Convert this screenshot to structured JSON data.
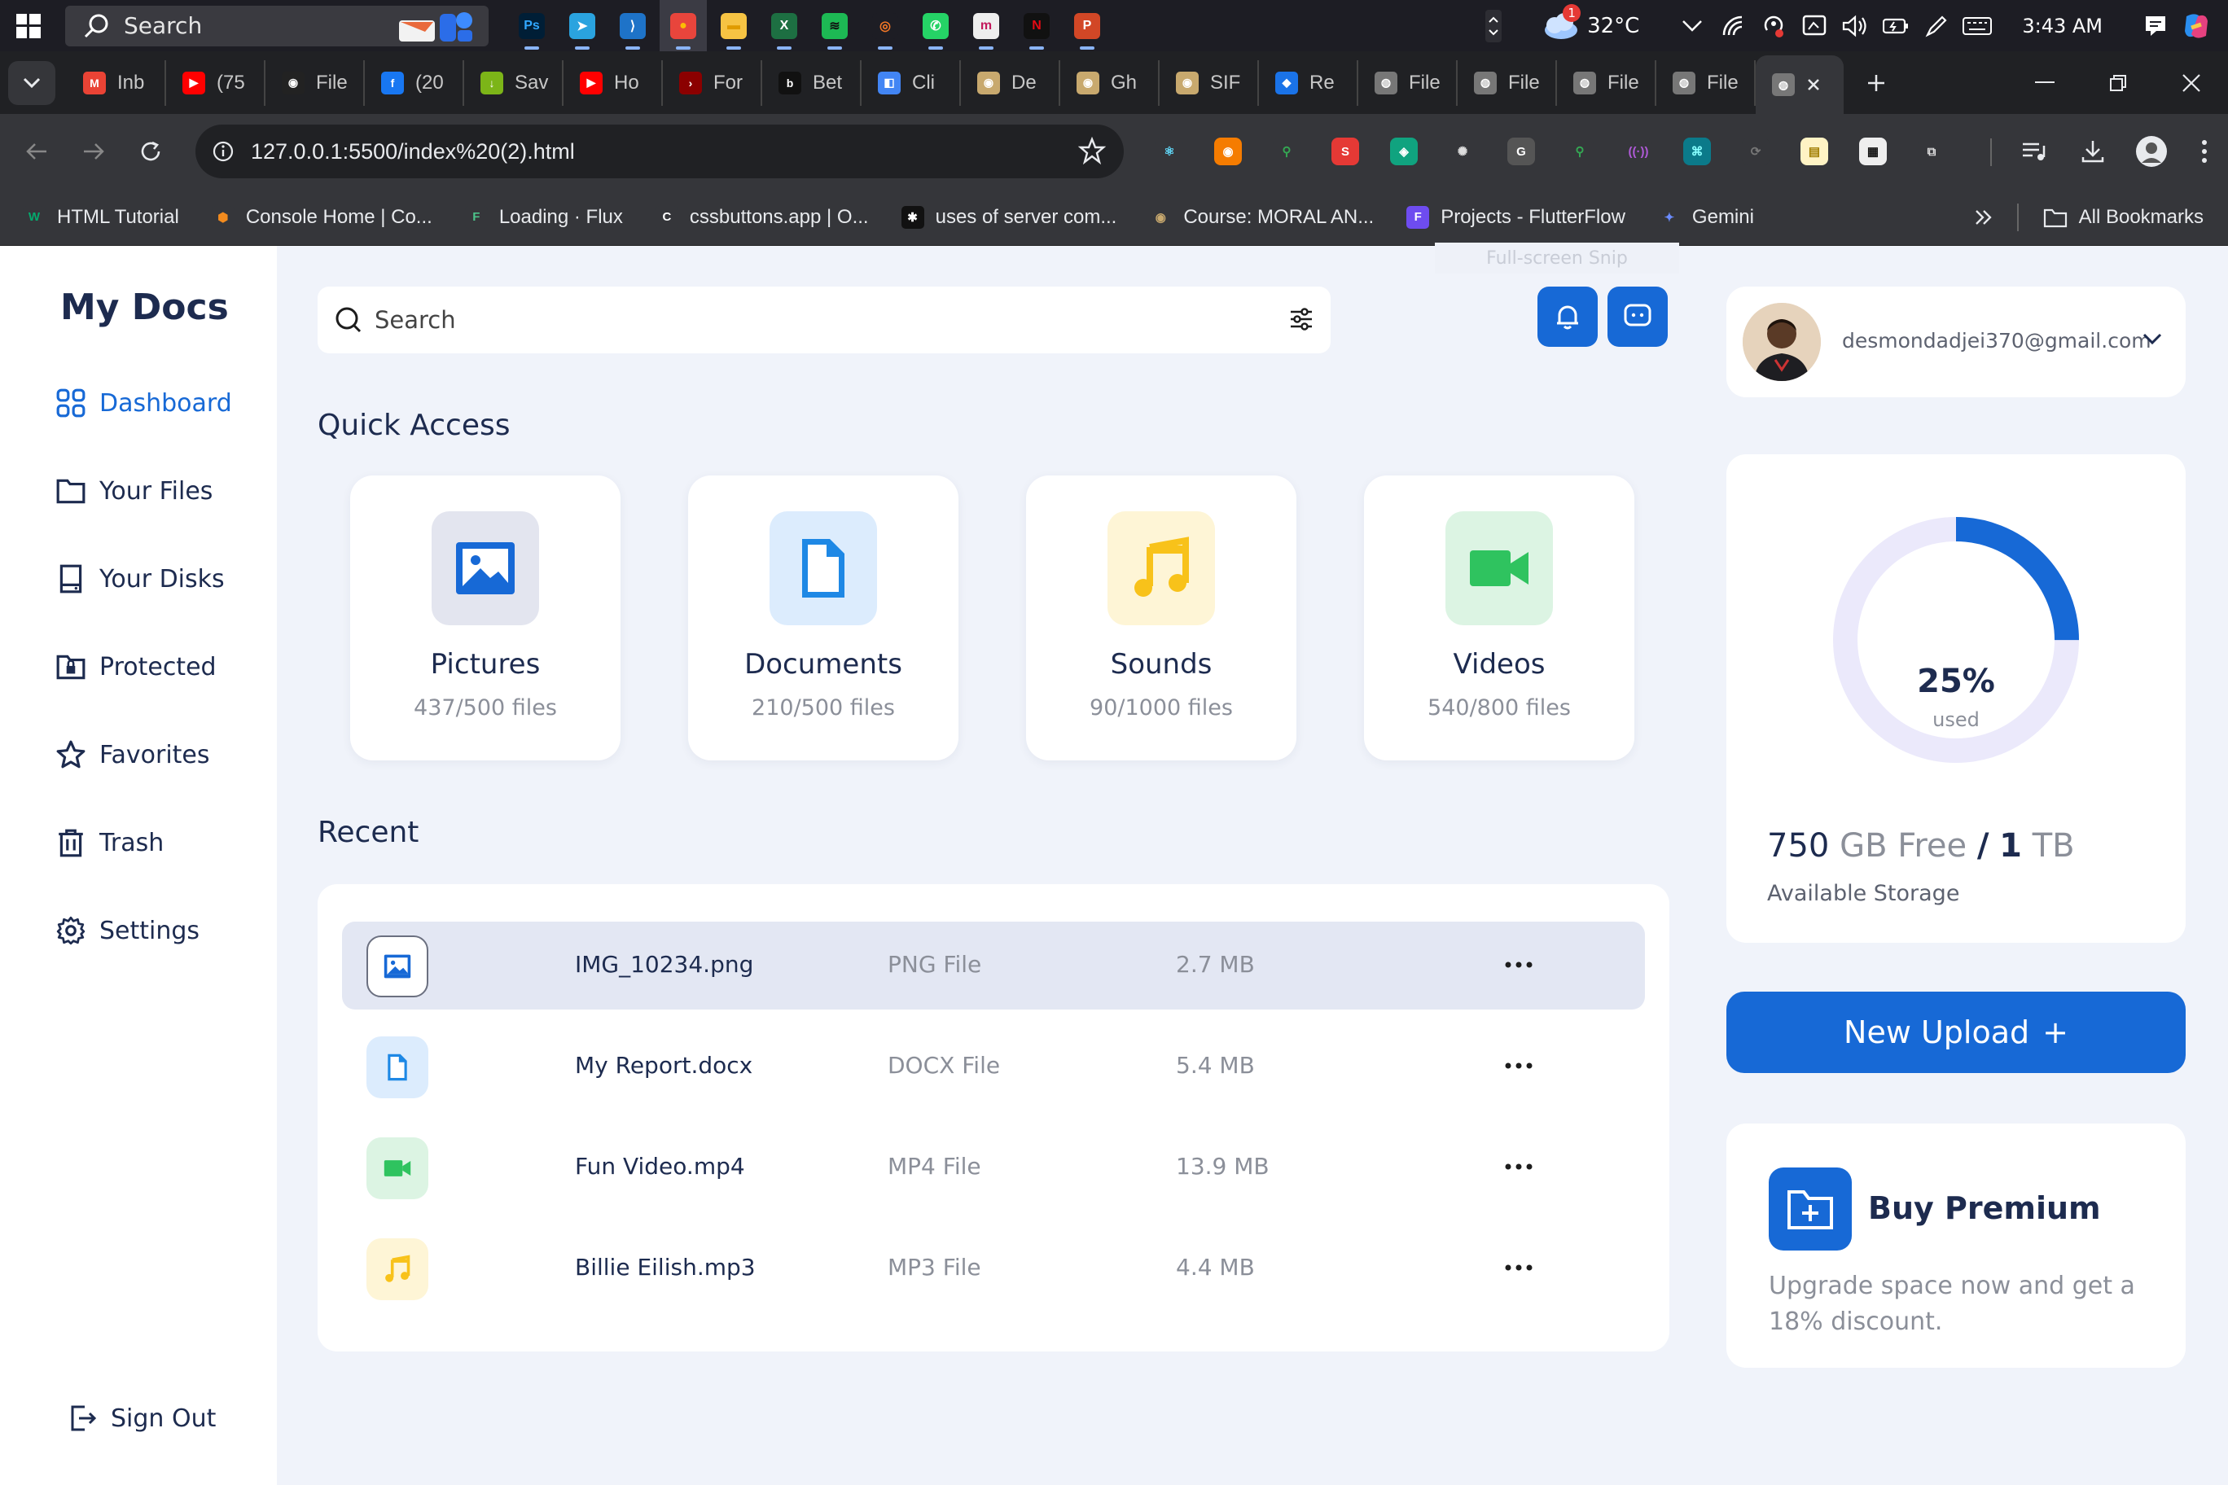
{
  "taskbar": {
    "search_placeholder": "Search",
    "apps": [
      {
        "name": "photoshop",
        "glyph": "Ps",
        "color": "#001e36",
        "fg": "#31a8ff"
      },
      {
        "name": "telegram",
        "glyph": "➤",
        "color": "#2aa3df",
        "fg": "#fff"
      },
      {
        "name": "vscode",
        "glyph": "⟩",
        "color": "#1e73c8",
        "fg": "#fff"
      },
      {
        "name": "chrome",
        "glyph": "●",
        "color": "#e8453c",
        "fg": "#fbbc05",
        "active": true
      },
      {
        "name": "file-explorer",
        "glyph": "▬",
        "color": "#f6c343",
        "fg": "#e09b00"
      },
      {
        "name": "excel",
        "glyph": "X",
        "color": "#1d6f42",
        "fg": "#fff"
      },
      {
        "name": "spotify",
        "glyph": "≋",
        "color": "#1db954",
        "fg": "#111"
      },
      {
        "name": "jupyter",
        "glyph": "◎",
        "color": "#1d1d24",
        "fg": "#f37726"
      },
      {
        "name": "whatsapp",
        "glyph": "✆",
        "color": "#25d366",
        "fg": "#fff"
      },
      {
        "name": "edge-app",
        "glyph": "m",
        "color": "#eee",
        "fg": "#c2185b"
      },
      {
        "name": "netflix",
        "glyph": "N",
        "color": "#111",
        "fg": "#e50914"
      },
      {
        "name": "powerpoint",
        "glyph": "P",
        "color": "#d24726",
        "fg": "#fff"
      }
    ],
    "weather_temp": "32°C",
    "weather_badge": "1",
    "time": "3:43 AM"
  },
  "tabs": [
    {
      "label": "Inb",
      "favicon": "M",
      "color": "#ea4335"
    },
    {
      "label": "(75",
      "favicon": "▶",
      "color": "#ff0000"
    },
    {
      "label": "File",
      "favicon": "◉",
      "color": "#222"
    },
    {
      "label": "(20",
      "favicon": "f",
      "color": "#1877f2"
    },
    {
      "label": "Sav",
      "favicon": "↓",
      "color": "#7cb518"
    },
    {
      "label": "Ho",
      "favicon": "▶",
      "color": "#ff0000"
    },
    {
      "label": "For",
      "favicon": "›",
      "color": "#8b0000"
    },
    {
      "label": "Bet",
      "favicon": "b",
      "color": "#111"
    },
    {
      "label": "Cli",
      "favicon": "◧",
      "color": "#4285f4"
    },
    {
      "label": "De",
      "favicon": "◉",
      "color": "#c8a96e"
    },
    {
      "label": "Gh",
      "favicon": "◉",
      "color": "#c8a96e"
    },
    {
      "label": "SIF",
      "favicon": "◉",
      "color": "#c8a96e"
    },
    {
      "label": "Re",
      "favicon": "◆",
      "color": "#1a73e8"
    },
    {
      "label": "File",
      "favicon": "◍",
      "color": "#777"
    },
    {
      "label": "File",
      "favicon": "◍",
      "color": "#777"
    },
    {
      "label": "File",
      "favicon": "◍",
      "color": "#777"
    },
    {
      "label": "File",
      "favicon": "◍",
      "color": "#777"
    }
  ],
  "browser": {
    "url": "127.0.0.1:5500/index%20(2).html"
  },
  "extensions": [
    {
      "name": "react-devtools",
      "glyph": "⚛",
      "color": "#35363a",
      "fg": "#61dafb"
    },
    {
      "name": "ext-orange",
      "glyph": "◉",
      "color": "#f57c00",
      "fg": "#fff"
    },
    {
      "name": "ext-green-search",
      "glyph": "⚲",
      "color": "#35363a",
      "fg": "#34a853"
    },
    {
      "name": "ext-s",
      "glyph": "S",
      "color": "#e53935",
      "fg": "#fff"
    },
    {
      "name": "ext-teal",
      "glyph": "◈",
      "color": "#10a37f",
      "fg": "#fff"
    },
    {
      "name": "openai",
      "glyph": "✺",
      "color": "#35363a",
      "fg": "#ddd"
    },
    {
      "name": "grammarly",
      "glyph": "G",
      "color": "#555",
      "fg": "#fff"
    },
    {
      "name": "ext-search",
      "glyph": "⚲",
      "color": "#35363a",
      "fg": "#34a853"
    },
    {
      "name": "ext-purple",
      "glyph": "((·))",
      "color": "#35363a",
      "fg": "#b05ad8"
    },
    {
      "name": "ext-cyan",
      "glyph": "⌘",
      "color": "#0b7a8a",
      "fg": "#8ff"
    },
    {
      "name": "ext-sync",
      "glyph": "⟳",
      "color": "#35363a",
      "fg": "#777"
    },
    {
      "name": "ext-note",
      "glyph": "▤",
      "color": "#fff3c4",
      "fg": "#a07d00"
    },
    {
      "name": "ext-qr",
      "glyph": "▦",
      "color": "#eee",
      "fg": "#111"
    },
    {
      "name": "puzzle",
      "glyph": "⧉",
      "color": "#35363a",
      "fg": "#ddd"
    }
  ],
  "bookmarks": [
    {
      "label": "HTML Tutorial",
      "icon": "W",
      "color": "#35363a",
      "fg": "#04aa6d"
    },
    {
      "label": "Console Home | Co...",
      "icon": "⬢",
      "color": "#35363a",
      "fg": "#f28b1e"
    },
    {
      "label": "Loading · Flux",
      "icon": "F",
      "color": "#35363a",
      "fg": "#4cc38a"
    },
    {
      "label": "cssbuttons.app | O...",
      "icon": "C",
      "color": "#35363a",
      "fg": "#fff"
    },
    {
      "label": "uses of server com...",
      "icon": "✱",
      "color": "#111",
      "fg": "#fff"
    },
    {
      "label": "Course: MORAL AN...",
      "icon": "◉",
      "color": "#35363a",
      "fg": "#c8a96e"
    },
    {
      "label": "Projects - FlutterFlow",
      "icon": "F",
      "color": "#6e4cf0",
      "fg": "#fff"
    },
    {
      "label": "Gemini",
      "icon": "✦",
      "color": "#35363a",
      "fg": "#6b8cff"
    }
  ],
  "bookmarks_all": "All Bookmarks",
  "snip_tooltip": "Full-screen Snip",
  "app": {
    "brand": "My Docs",
    "nav": [
      {
        "label": "Dashboard",
        "icon": "grid-icon",
        "active": true
      },
      {
        "label": "Your Files",
        "icon": "folder-icon"
      },
      {
        "label": "Your Disks",
        "icon": "disk-icon"
      },
      {
        "label": "Protected",
        "icon": "lock-folder-icon"
      },
      {
        "label": "Favorites",
        "icon": "star-icon"
      },
      {
        "label": "Trash",
        "icon": "trash-icon"
      },
      {
        "label": "Settings",
        "icon": "gear-icon"
      }
    ],
    "sign_out": "Sign Out",
    "search_placeholder": "Search",
    "quick_access_title": "Quick Access",
    "quick_access": [
      {
        "name": "Pictures",
        "count": "437/500 files",
        "icon": "image-icon",
        "tile": "#e3e5ef",
        "accent": "#1769d6"
      },
      {
        "name": "Documents",
        "count": "210/500 files",
        "icon": "document-icon",
        "tile": "#dcecfd",
        "accent": "#1e88e5"
      },
      {
        "name": "Sounds",
        "count": "90/1000 files",
        "icon": "music-icon",
        "tile": "#fef5d6",
        "accent": "#f8c21a"
      },
      {
        "name": "Videos",
        "count": "540/800 files",
        "icon": "video-icon",
        "tile": "#dcf4e3",
        "accent": "#2fc35f"
      }
    ],
    "recent_title": "Recent",
    "recent": [
      {
        "name": "IMG_10234.png",
        "type": "PNG File",
        "size": "2.7 MB",
        "icon": "image-icon",
        "tile": "#e3e7f3",
        "accent": "#1769d6",
        "selected": true
      },
      {
        "name": "My Report.docx",
        "type": "DOCX File",
        "size": "5.4 MB",
        "icon": "document-icon",
        "tile": "#dcecfd",
        "accent": "#1e88e5"
      },
      {
        "name": "Fun Video.mp4",
        "type": "MP4 File",
        "size": "13.9 MB",
        "icon": "video-icon",
        "tile": "#dcf4e3",
        "accent": "#2fc35f"
      },
      {
        "name": "Billie Eilish.mp3",
        "type": "MP3 File",
        "size": "4.4 MB",
        "icon": "music-icon",
        "tile": "#fef5d6",
        "accent": "#f8c21a"
      }
    ],
    "email": "desmondadjei370@gmail.com",
    "storage": {
      "used_percent": 25,
      "pct_label": "25%",
      "used_label": "used",
      "free_value": "750",
      "free_unit": "GB Free",
      "slash": "/",
      "total_value": "1",
      "total_unit": "TB",
      "caption": "Available Storage"
    },
    "upload_label": "New Upload",
    "upload_plus": "+",
    "premium": {
      "title": "Buy Premium",
      "desc": "Upgrade space now and get a 18% discount."
    },
    "colors": {
      "primary": "#1769d6",
      "text": "#1d2b4f",
      "muted": "#8b8f99",
      "donut_track": "#ebe9fb"
    }
  }
}
